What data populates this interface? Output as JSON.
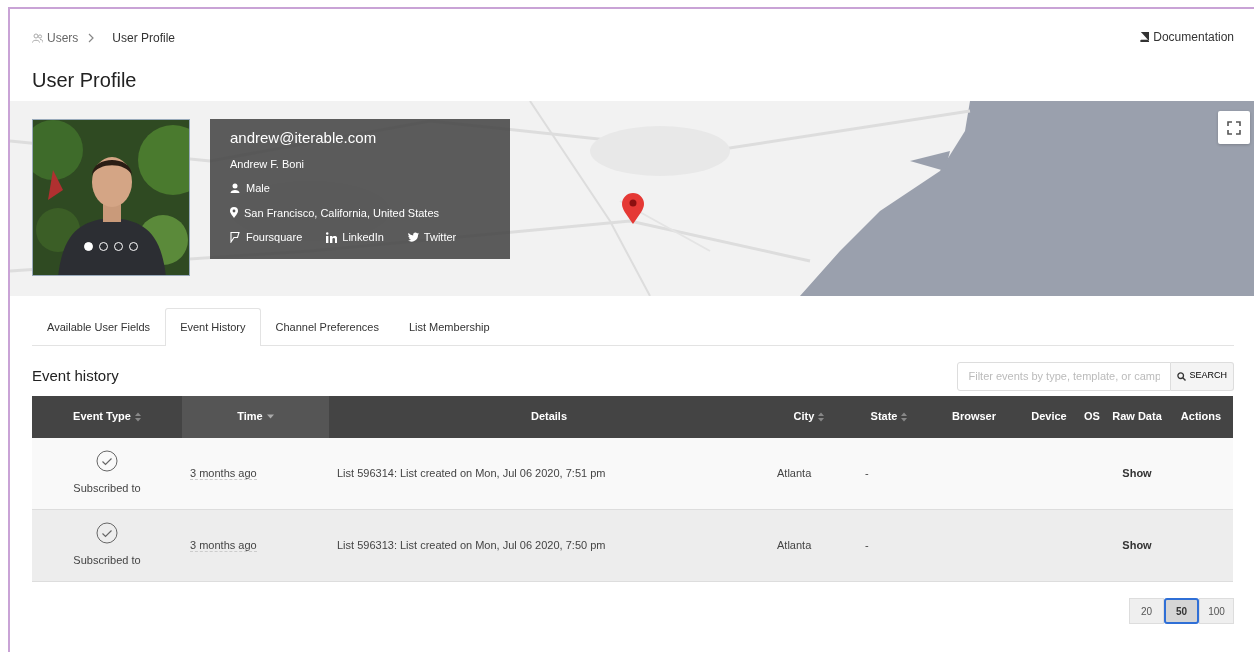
{
  "breadcrumb": [
    {
      "label": "Users"
    },
    {
      "label": "User Profile"
    }
  ],
  "documentation_link": "Documentation",
  "title": "User Profile",
  "profile": {
    "email": "andrew@iterable.com",
    "name": "Andrew F. Boni",
    "gender": "Male",
    "location": "San Francisco, California, United States",
    "social": [
      {
        "kind": "foursquare",
        "label": "Foursquare"
      },
      {
        "kind": "linkedin",
        "label": "LinkedIn"
      },
      {
        "kind": "twitter",
        "label": "Twitter"
      }
    ]
  },
  "carousel_dots": [
    {
      "selected": true
    },
    {
      "selected": false
    },
    {
      "selected": false
    },
    {
      "selected": false
    }
  ],
  "tabs": [
    {
      "label": "Available User Fields",
      "selected": false
    },
    {
      "label": "Event History",
      "selected": true
    },
    {
      "label": "Channel Preferences",
      "selected": false
    },
    {
      "label": "List Membership",
      "selected": false
    }
  ],
  "section_title": "Event history",
  "search": {
    "placeholder": "Filter events by type, template, or camp",
    "button": "SEARCH"
  },
  "table": {
    "columns": [
      {
        "label": "Event Type",
        "sortable": true,
        "sorted": false
      },
      {
        "label": "Time",
        "sortable": true,
        "sorted": true
      },
      {
        "label": "Details",
        "sortable": false,
        "sorted": false
      },
      {
        "label": "City",
        "sortable": true,
        "sorted": false
      },
      {
        "label": "State",
        "sortable": true,
        "sorted": false
      },
      {
        "label": "Browser",
        "sortable": false,
        "sorted": false
      },
      {
        "label": "Device",
        "sortable": false,
        "sorted": false
      },
      {
        "label": "OS",
        "sortable": false,
        "sorted": false
      },
      {
        "label": "Raw Data",
        "sortable": false,
        "sorted": false
      },
      {
        "label": "Actions",
        "sortable": false,
        "sorted": false
      }
    ],
    "rows": [
      {
        "event_type": "Subscribed to",
        "time": "3 months ago",
        "details": "List 596314: List created on Mon, Jul 06 2020, 7:51 pm",
        "city": "Atlanta",
        "state": "-",
        "raw_data": "Show"
      },
      {
        "event_type": "Subscribed to",
        "time": "3 months ago",
        "details": "List 596313: List created on Mon, Jul 06 2020, 7:50 pm",
        "city": "Atlanta",
        "state": "-",
        "raw_data": "Show"
      }
    ]
  },
  "page_sizes": [
    {
      "label": "20",
      "selected": false
    },
    {
      "label": "50",
      "selected": true
    },
    {
      "label": "100",
      "selected": false
    }
  ]
}
